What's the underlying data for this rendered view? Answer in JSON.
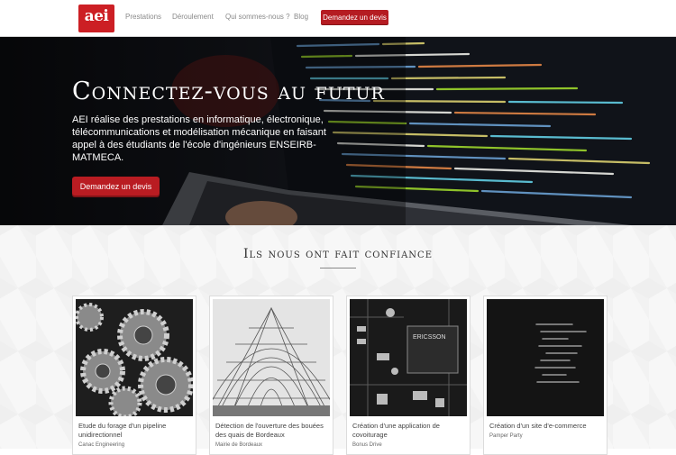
{
  "nav": {
    "logo_text": "aei",
    "links": [
      "Prestations",
      "Déroulement",
      "Qui sommes-nous ?",
      "Blog"
    ],
    "cta_label": "Demandez un devis"
  },
  "hero": {
    "title": "Connectez-vous au futur",
    "description": "AEI réalise des prestations en informatique, électronique, télécommunications et modélisation mécanique en faisant appel à des étudiants de l'école d'ingénieurs ENSEIRB-MATMECA.",
    "cta_label": "Demandez un devis"
  },
  "clients": {
    "title": "Ils nous ont fait confiance",
    "cards": [
      {
        "title": "Etude du forage d'un pipeline unidirectionnel",
        "client": "Canac Engineering"
      },
      {
        "title": "Détection de l'ouverture des bouées des quais de Bordeaux",
        "client": "Mairie de Bordeaux"
      },
      {
        "title": "Création d'une application de covoiturage",
        "client": "Bonus Drive"
      },
      {
        "title": "Création d'un site d'e-commerce",
        "client": "Pamper Party"
      }
    ],
    "chip_label": "ERICSSON"
  },
  "colors": {
    "brand_red": "#cc1f24",
    "button_red": "#b91c22"
  }
}
